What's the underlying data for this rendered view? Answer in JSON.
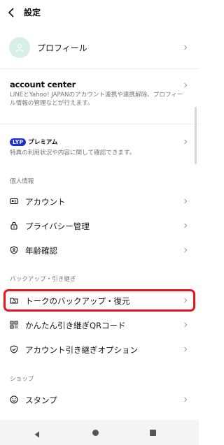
{
  "header": {
    "title": "設定"
  },
  "profile": {
    "label": "プロフィール"
  },
  "account_center": {
    "title": "account center",
    "description": "LINEとYahoo! JAPANのアカウント連携や連携解除、プロフィール情報の管理などが行えます。"
  },
  "lyp": {
    "badge": "LYP",
    "badge_suffix": "プレミアム",
    "description": "特典の利用状況や内容に関して確認できます。"
  },
  "sections": {
    "personal": "個人情報",
    "backup": "バックアップ・引き継ぎ",
    "shop": "ショップ"
  },
  "items": {
    "account": "アカウント",
    "privacy": "プライバシー管理",
    "age": "年齢確認",
    "talk_backup": "トークのバックアップ・復元",
    "qr_transfer": "かんたん引き継ぎQRコード",
    "transfer_option": "アカウント引き継ぎオプション",
    "stamp": "スタンプ"
  },
  "colors": {
    "highlight": "#e8121b",
    "lyp_blue": "#1b2fd6",
    "avatar_bg": "#d8efe8"
  }
}
